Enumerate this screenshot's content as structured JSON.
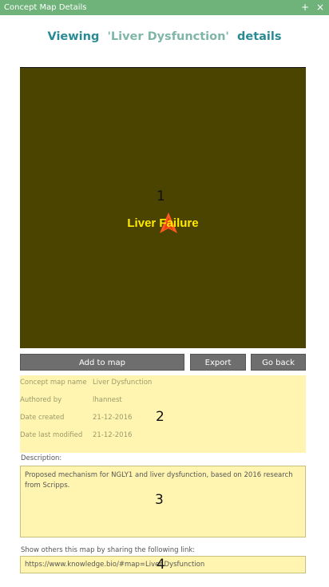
{
  "window": {
    "title": "Concept Map Details",
    "controls": {
      "maximize": "+",
      "close": "×"
    }
  },
  "heading": {
    "prefix": "Viewing",
    "name": "'Liver Dysfunction'",
    "suffix": "details"
  },
  "map": {
    "node_label": "Liver Failure",
    "background": "#4b4300",
    "node_color": "#ffea00",
    "marker_color": "#ff5a1f"
  },
  "callouts": [
    "1",
    "2",
    "3",
    "4"
  ],
  "buttons": {
    "add_to_map": "Add to map",
    "export": "Export",
    "go_back": "Go back"
  },
  "info": {
    "rows": [
      {
        "key": "Concept map name",
        "value": "Liver Dysfunction"
      },
      {
        "key": "Authored by",
        "value": "lhannest"
      },
      {
        "key": "Date created",
        "value": "21-12-2016"
      },
      {
        "key": "Date last modified",
        "value": "21-12-2016"
      }
    ]
  },
  "description": {
    "label": "Description:",
    "text": "Proposed mechanism for NGLY1 and liver dysfunction, based on 2016 research from Scripps."
  },
  "share": {
    "label": "Show others this map by sharing the following link:",
    "url": "https://www.knowledge.bio/#map=Liver Dysfunction"
  }
}
